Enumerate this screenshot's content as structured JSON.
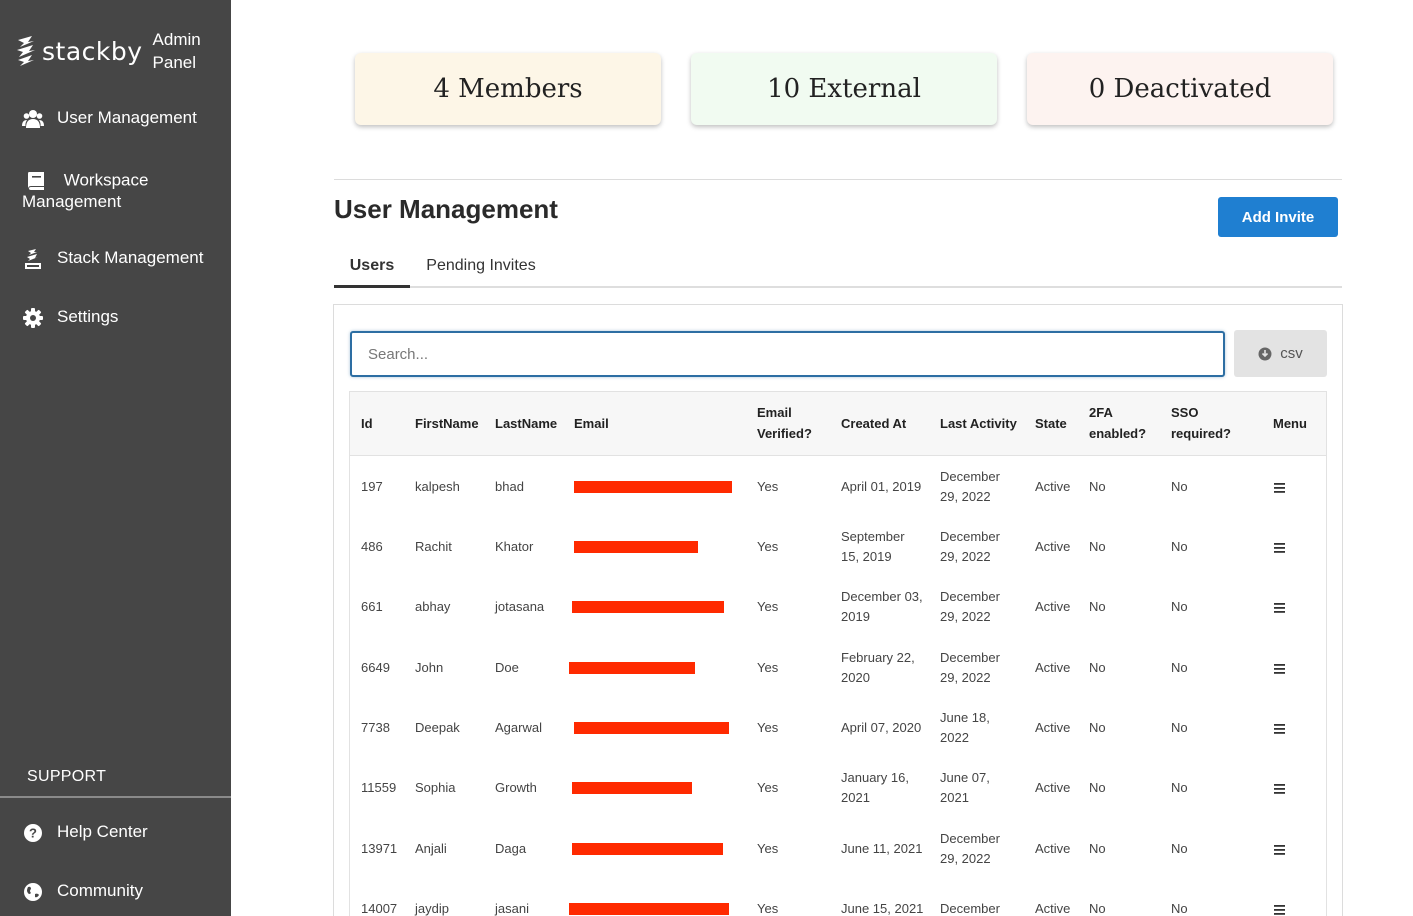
{
  "sidebar": {
    "brand": "stackby",
    "brand_sub_line1": "Admin",
    "brand_sub_line2": "Panel",
    "items": [
      {
        "label": "User Management",
        "icon": "users-icon"
      },
      {
        "label_line1": "Workspace",
        "label_line2": "Management",
        "icon": "book-icon"
      },
      {
        "label": "Stack Management",
        "icon": "stack-icon"
      },
      {
        "label": "Settings",
        "icon": "gear-icon"
      }
    ],
    "support_label": "SUPPORT",
    "support_items": [
      {
        "label": "Help Center",
        "icon": "question-circle-icon"
      },
      {
        "label": "Community",
        "icon": "globe-icon"
      }
    ]
  },
  "stats": [
    {
      "label": "4 Members",
      "color": "#fdf6e7"
    },
    {
      "label": "10 External",
      "color": "#f1fbf1"
    },
    {
      "label": "0 Deactivated",
      "color": "#fdf3f0"
    }
  ],
  "main": {
    "title": "User Management",
    "add_invite_label": "Add Invite",
    "tabs": [
      {
        "label": "Users",
        "active": true
      },
      {
        "label": "Pending Invites",
        "active": false
      }
    ],
    "search_placeholder": "Search...",
    "csv_label": "csv"
  },
  "table": {
    "headers": {
      "id": "Id",
      "firstname": "FirstName",
      "lastname": "LastName",
      "email": "Email",
      "email_verified_1": "Email",
      "email_verified_2": "Verified?",
      "created_at": "Created At",
      "last_activity": "Last Activity",
      "state": "State",
      "twofa_1": "2FA",
      "twofa_2": "enabled?",
      "sso_1": "SSO",
      "sso_2": "required?",
      "menu": "Menu"
    },
    "rows": [
      {
        "id": "197",
        "first": "kalpesh",
        "last": "bhad",
        "verified": "Yes",
        "created1": "April 01, 2019",
        "created2": "",
        "activity1": "December",
        "activity2": "29, 2022",
        "state": "Active",
        "twofa": "No",
        "sso": "No"
      },
      {
        "id": "486",
        "first": "Rachit",
        "last": "Khator",
        "verified": "Yes",
        "created1": "September",
        "created2": "15, 2019",
        "activity1": "December",
        "activity2": "29, 2022",
        "state": "Active",
        "twofa": "No",
        "sso": "No"
      },
      {
        "id": "661",
        "first": "abhay",
        "last": "jotasana",
        "verified": "Yes",
        "created1": "December 03,",
        "created2": "2019",
        "activity1": "December",
        "activity2": "29, 2022",
        "state": "Active",
        "twofa": "No",
        "sso": "No"
      },
      {
        "id": "6649",
        "first": "John",
        "last": "Doe",
        "verified": "Yes",
        "created1": "February 22,",
        "created2": "2020",
        "activity1": "December",
        "activity2": "29, 2022",
        "state": "Active",
        "twofa": "No",
        "sso": "No"
      },
      {
        "id": "7738",
        "first": "Deepak",
        "last": "Agarwal",
        "verified": "Yes",
        "created1": "April 07, 2020",
        "created2": "",
        "activity1": "June 18,",
        "activity2": "2022",
        "state": "Active",
        "twofa": "No",
        "sso": "No"
      },
      {
        "id": "11559",
        "first": "Sophia",
        "last": "Growth",
        "verified": "Yes",
        "created1": "January 16,",
        "created2": "2021",
        "activity1": "June 07,",
        "activity2": "2021",
        "state": "Active",
        "twofa": "No",
        "sso": "No"
      },
      {
        "id": "13971",
        "first": "Anjali",
        "last": "Daga",
        "verified": "Yes",
        "created1": "June 11, 2021",
        "created2": "",
        "activity1": "December",
        "activity2": "29, 2022",
        "state": "Active",
        "twofa": "No",
        "sso": "No"
      },
      {
        "id": "14007",
        "first": "jaydip",
        "last": "jasani",
        "verified": "Yes",
        "created1": "June 15, 2021",
        "created2": "",
        "activity1": "December",
        "activity2": "",
        "state": "Active",
        "twofa": "No",
        "sso": "No"
      }
    ]
  },
  "colors": {
    "sidebar": "#464646",
    "accent": "#1f7fd1",
    "redaction": "#ff2a00"
  }
}
